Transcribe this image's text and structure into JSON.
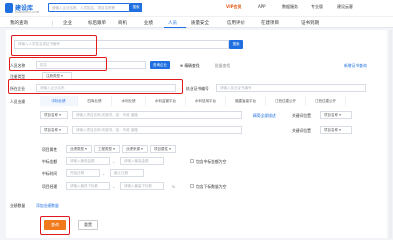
{
  "brand": {
    "name": "建设库",
    "sub": "JIANSHEKU.COM"
  },
  "top": {
    "search_placeholder": "请输入企业名称、人员姓名、项目名称等",
    "search_btn": "搜索",
    "vip": "VIP会员",
    "app": "APP",
    "data_service": "数据服务",
    "enterprise": "专业版",
    "user": "建设云客"
  },
  "nav": [
    "我的查询",
    "企业",
    "标后跟单",
    "商机",
    "业绩",
    "人员",
    "质量安全",
    "信用评价",
    "在建项目",
    "证书到期"
  ],
  "search_row": {
    "placeholder": "请输入人员姓名或证书编号",
    "btn": "搜索"
  },
  "name_row": {
    "label": "人员名称",
    "placeholder": "姓名",
    "btn": "查询企业",
    "check": "精确查找",
    "check2": "批量查找",
    "link": "新增证书查询"
  },
  "qual_row": {
    "label": "注册类型",
    "select": "注册类型"
  },
  "company_row": {
    "label": "所在企业",
    "placeholder": "请输入企业名称",
    "label2": "执业证书编号",
    "placeholder2": "请输入执业证书编号"
  },
  "tabs": {
    "label": "人员业绩",
    "items": [
      "中标业绩",
      "四库业绩",
      "水利业绩",
      "水利监管平台",
      "水利信用平台",
      "福建省级平台",
      "江西住建公开",
      "江西住建公开"
    ]
  },
  "project_rows": [
    {
      "label": "项目名称",
      "placeholder": "请输入项目名称/关键词，如：市政 道路",
      "link": "精简全部描述",
      "label2": "关键词位置",
      "select2": "项目名称"
    },
    {
      "label": "项目名称",
      "placeholder": "请输入项目名称/关键词，如：市政 道路",
      "link": "",
      "label2": "关键词位置",
      "select2": "项目名称"
    }
  ],
  "attrs": {
    "label": "项目属性",
    "items": [
      "业绩类型",
      "工程类型",
      "业绩来源",
      "项目属性"
    ]
  },
  "amount": {
    "label": "中标金额",
    "ph1": "请输入最低金额",
    "ph2": "请输入最高金额",
    "check": "包含中标金额为空"
  },
  "date": {
    "label": "中标时间",
    "ph1": "开始日期",
    "ph2": "截止日期"
  },
  "builder": {
    "label": "项目经理",
    "ph1": "请输入最低下标数",
    "ph2": "请输入最高下标数",
    "check": "包含下标数量为空"
  },
  "count": {
    "label": "业绩数量",
    "link": "添加业绩数量"
  },
  "actions": {
    "query": "查询",
    "reset": "重置"
  }
}
